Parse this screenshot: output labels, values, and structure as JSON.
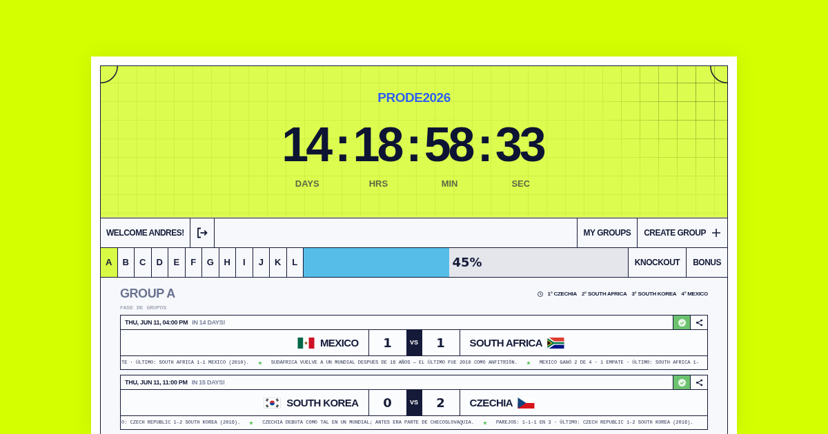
{
  "header": {
    "brand": "PRODE2026",
    "countdown": [
      {
        "kind": "unit",
        "value": "14",
        "unit": "DAYS"
      },
      {
        "kind": "separator",
        "text": ":"
      },
      {
        "kind": "unit",
        "value": "18",
        "unit": "HRS"
      },
      {
        "kind": "separator",
        "text": ":"
      },
      {
        "kind": "unit",
        "value": "58",
        "unit": "MIN"
      },
      {
        "kind": "separator",
        "text": ":"
      },
      {
        "kind": "unit",
        "value": "33",
        "unit": "SEC"
      }
    ]
  },
  "user_bar": {
    "welcome": "WELCOME ANDRES!",
    "links": [
      {
        "kind": "link",
        "label": "MY GROUPS"
      },
      {
        "kind": "create",
        "label": "CREATE GROUP"
      }
    ]
  },
  "group_tabs": [
    {
      "label": "A",
      "selected": true
    },
    {
      "label": "B",
      "selected": false
    },
    {
      "label": "C",
      "selected": false
    },
    {
      "label": "D",
      "selected": false
    },
    {
      "label": "E",
      "selected": false
    },
    {
      "label": "F",
      "selected": false
    },
    {
      "label": "G",
      "selected": false
    },
    {
      "label": "H",
      "selected": false
    },
    {
      "label": "I",
      "selected": false
    },
    {
      "label": "J",
      "selected": false
    },
    {
      "label": "K",
      "selected": false
    },
    {
      "label": "L",
      "selected": false
    }
  ],
  "progress": {
    "level": 0.45,
    "reading": "45%"
  },
  "stage_tabs": [
    "KNOCKOUT",
    "BONUS"
  ],
  "group": {
    "title": "GROUP A",
    "subtitle": "FASE DE GRUPOS",
    "standings": [
      "1° CZECHIA",
      "2° SOUTH AFRICA",
      "3° SOUTH KOREA",
      "4° MEXICO"
    ]
  },
  "matches": [
    {
      "date": "THU, JUN 11, 04:00 PM",
      "countdown": "IN 14 DAYS!",
      "saved": true,
      "vs": "VS",
      "teams": [
        {
          "kind": "mexico",
          "name": "MEXICO",
          "score": "1"
        },
        {
          "kind": "southafrica",
          "name": "SOUTH AFRICA",
          "score": "1"
        }
      ],
      "notes": [
        "TE · ÚLTIMO: SOUTH AFRICA 1-1 MEXICO (2010).",
        "SUDÁFRICA VUELVE A UN MUNDIAL DESPUÉS DE 16 AÑOS — EL ÚLTIMO FUE 2010 COMO ANFITRIÓN.",
        "MEXICO GANÓ 2 DE 4 · 1 EMPATE · ÚLTIMO: SOUTH AFRICA 1-"
      ]
    },
    {
      "date": "THU, JUN 11, 11:00 PM",
      "countdown": "IN 15 DAYS!",
      "saved": true,
      "vs": "VS",
      "teams": [
        {
          "kind": "southkorea",
          "name": "SOUTH KOREA",
          "score": "0"
        },
        {
          "kind": "czechia",
          "name": "CZECHIA",
          "score": "2"
        }
      ],
      "notes": [
        "O: CZECH REPUBLIC 1-2 SOUTH KOREA (2016).",
        "CZECHIA DEBUTA COMO TAL EN UN MUNDIAL; ANTES ERA PARTE DE CHECOSLOVAQUIA.",
        "PAREJOS: 1-1-1 EN 3 · ÚLTIMO: CZECH REPUBLIC 1-2 SOUTH KOREA (2016)."
      ]
    }
  ]
}
